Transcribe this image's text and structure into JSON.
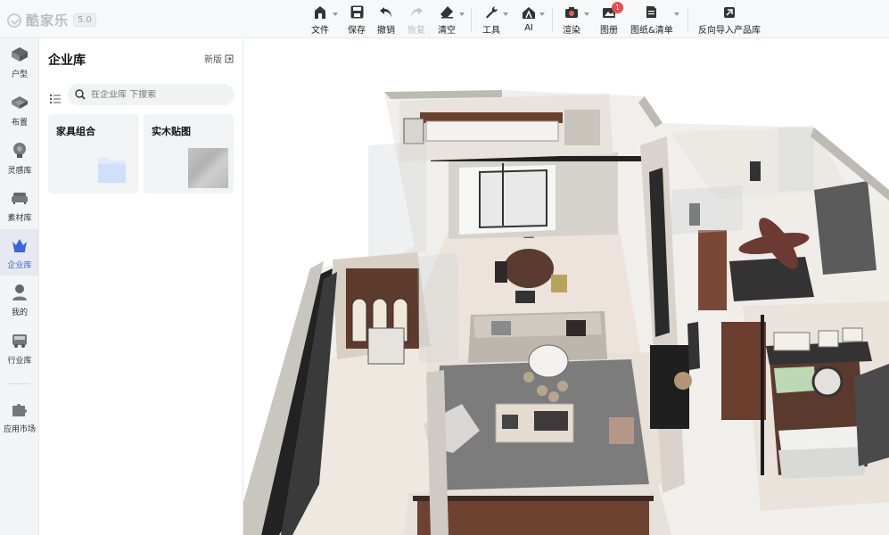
{
  "app": {
    "logo_text": "酷家乐",
    "version": "5.0"
  },
  "toolbar": {
    "file": "文件",
    "save": "保存",
    "undo": "撤销",
    "redo": "恢复",
    "clear": "清空",
    "tools": "工具",
    "ai": "AI",
    "render": "渲染",
    "album": "图册",
    "album_badge": "1",
    "drawings": "图纸&清单",
    "reverse_import": "反向导入产品库"
  },
  "rail": {
    "items": [
      {
        "label": "户型",
        "icon": "floorplan-icon"
      },
      {
        "label": "布置",
        "icon": "layout-icon"
      },
      {
        "label": "灵感库",
        "icon": "lightbulb-icon"
      },
      {
        "label": "素材库",
        "icon": "sofa-icon"
      },
      {
        "label": "企业库",
        "icon": "crown-icon"
      },
      {
        "label": "我的",
        "icon": "user-icon"
      },
      {
        "label": "行业库",
        "icon": "truck-icon"
      },
      {
        "label": "应用市场",
        "icon": "puzzle-icon"
      }
    ]
  },
  "panel": {
    "title": "企业库",
    "new_version": "新版",
    "search_placeholder": "在企业库 下搜索",
    "cards": [
      {
        "title": "家具组合"
      },
      {
        "title": "实木贴图"
      }
    ]
  },
  "colors": {
    "accent": "#3a64e8",
    "badge": "#f04b4b"
  }
}
